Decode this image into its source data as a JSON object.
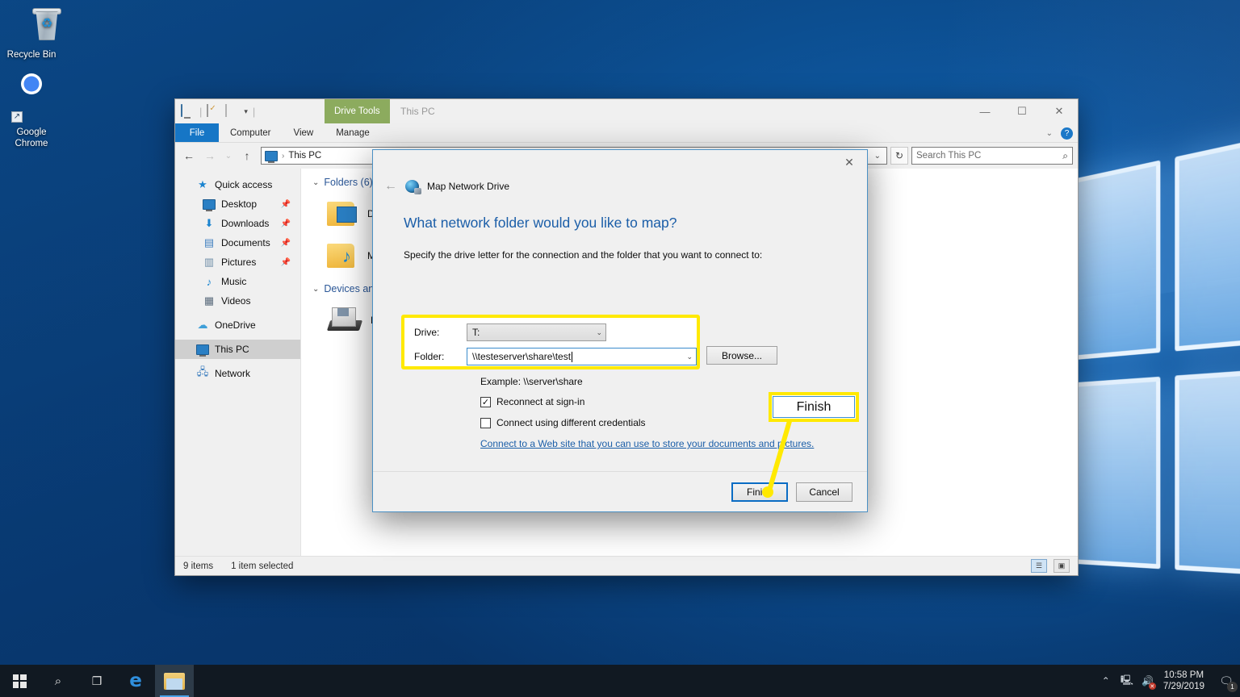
{
  "desktop": {
    "icons": [
      {
        "name": "Recycle Bin",
        "icon": "recycle-bin-icon"
      },
      {
        "name": "Google Chrome",
        "icon": "chrome-icon"
      }
    ]
  },
  "explorer": {
    "window_title": "This PC",
    "contextual_tab": "Drive Tools",
    "quick_access_toolbar": [
      "this-pc-icon",
      "properties-icon",
      "new-folder-icon",
      "customize-caret-icon"
    ],
    "ribbon_tabs": [
      "File",
      "Computer",
      "View",
      "Manage"
    ],
    "window_controls": {
      "minimize": "—",
      "maximize": "☐",
      "close": "✕"
    },
    "ribbon_right": {
      "collapse": "⌄",
      "help": "?"
    },
    "nav": {
      "back": "←",
      "forward": "→",
      "recent": "⌄",
      "up": "↑",
      "breadcrumb_icon": "this-pc-icon",
      "breadcrumb": "This PC",
      "dropdown": "⌄",
      "refresh": "↻"
    },
    "search": {
      "placeholder": "Search This PC",
      "icon": "search-icon"
    },
    "sidebar": [
      {
        "label": "Quick access",
        "icon": "star-icon",
        "pinned": false,
        "indent": false,
        "selected": false
      },
      {
        "label": "Desktop",
        "icon": "desktop-icon",
        "pinned": true,
        "indent": true,
        "selected": false
      },
      {
        "label": "Downloads",
        "icon": "download-icon",
        "pinned": true,
        "indent": true,
        "selected": false
      },
      {
        "label": "Documents",
        "icon": "documents-icon",
        "pinned": true,
        "indent": true,
        "selected": false
      },
      {
        "label": "Pictures",
        "icon": "pictures-icon",
        "pinned": true,
        "indent": true,
        "selected": false
      },
      {
        "label": "Music",
        "icon": "music-icon",
        "pinned": false,
        "indent": true,
        "selected": false
      },
      {
        "label": "Videos",
        "icon": "videos-icon",
        "pinned": false,
        "indent": true,
        "selected": false
      },
      {
        "label": "OneDrive",
        "icon": "onedrive-icon",
        "pinned": false,
        "indent": false,
        "selected": false
      },
      {
        "label": "This PC",
        "icon": "this-pc-icon",
        "pinned": false,
        "indent": false,
        "selected": true
      },
      {
        "label": "Network",
        "icon": "network-icon",
        "pinned": false,
        "indent": false,
        "selected": false
      }
    ],
    "groups": [
      {
        "header": "Folders (6)",
        "items": [
          {
            "label": "Desktop",
            "icon": "folder-desktop-icon"
          },
          {
            "label": "Music",
            "icon": "folder-music-icon"
          }
        ]
      },
      {
        "header": "Devices and drives",
        "items": [
          {
            "label": "Floppy Disk Drive (A:)",
            "icon": "floppy-drive-icon"
          }
        ]
      }
    ],
    "status": {
      "items": "9 items",
      "selected": "1 item selected",
      "view_details": "details-view-icon",
      "view_large": "large-icons-view-icon"
    }
  },
  "dialog": {
    "title": "Map Network Drive",
    "title_icon": "map-network-drive-icon",
    "back": "←",
    "close": "✕",
    "heading": "What network folder would you like to map?",
    "subtext": "Specify the drive letter for the connection and the folder that you want to connect to:",
    "drive_label": "Drive:",
    "drive_value": "T:",
    "folder_label": "Folder:",
    "folder_value": "\\\\testeserver\\share\\test",
    "browse_button": "Browse...",
    "example": "Example: \\\\server\\share",
    "reconnect_label": "Reconnect at sign-in",
    "reconnect_checked": "✓",
    "credentials_label": "Connect using different credentials",
    "credentials_checked": "",
    "web_link": "Connect to a Web site that you can use to store your documents and pictures.",
    "finish_button": "Finish",
    "cancel_button": "Cancel"
  },
  "annotation": {
    "callout_label": "Finish",
    "highlight_color": "#ffe900",
    "callout_border_inner": "#3c8fd0"
  },
  "taskbar": {
    "start": "start-button",
    "search": "search-icon",
    "task_view": "task-view-icon",
    "apps": [
      {
        "name": "Microsoft Edge",
        "icon": "edge-icon",
        "active": false
      },
      {
        "name": "File Explorer",
        "icon": "file-explorer-icon",
        "active": true
      }
    ],
    "tray": {
      "chevron": "⌃",
      "network": "network-tray-icon",
      "volume": "volume-muted-icon"
    },
    "clock": {
      "time": "10:58 PM",
      "date": "7/29/2019"
    },
    "action_center": {
      "icon": "action-center-icon",
      "badge": "1"
    }
  }
}
